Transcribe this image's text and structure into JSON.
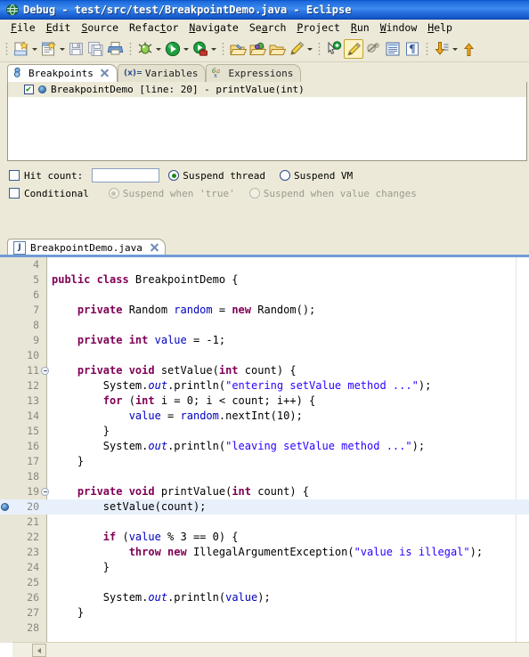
{
  "window": {
    "title": "Debug - test/src/test/BreakpointDemo.java - Eclipse",
    "icon": "eclipse-globe-icon"
  },
  "menubar": {
    "items": [
      {
        "label": "File",
        "mnemonic": "F"
      },
      {
        "label": "Edit",
        "mnemonic": "E"
      },
      {
        "label": "Source",
        "mnemonic": "S"
      },
      {
        "label": "Refactor",
        "mnemonic": "t"
      },
      {
        "label": "Navigate",
        "mnemonic": "N"
      },
      {
        "label": "Search",
        "mnemonic": "a"
      },
      {
        "label": "Project",
        "mnemonic": "P"
      },
      {
        "label": "Run",
        "mnemonic": "R"
      },
      {
        "label": "Window",
        "mnemonic": "W"
      },
      {
        "label": "Help",
        "mnemonic": "H"
      }
    ]
  },
  "toolbar": {
    "groups": [
      {
        "buttons": [
          {
            "icon": "new-wizard-icon",
            "dropdown": true
          },
          {
            "icon": "new-java-class-icon",
            "dropdown": true
          },
          {
            "icon": "save-icon",
            "dropdown": false
          },
          {
            "icon": "save-all-icon",
            "dropdown": false
          },
          {
            "icon": "print-icon",
            "dropdown": false
          }
        ]
      },
      {
        "buttons": [
          {
            "icon": "debug-bug-icon",
            "dropdown": true
          },
          {
            "icon": "run-play-icon",
            "dropdown": true
          },
          {
            "icon": "external-tools-icon",
            "dropdown": true
          }
        ]
      },
      {
        "buttons": [
          {
            "icon": "open-type-icon",
            "dropdown": false
          },
          {
            "icon": "open-task-icon",
            "dropdown": false
          },
          {
            "icon": "open-resource-icon",
            "dropdown": false
          },
          {
            "icon": "quick-fix-pencil-icon",
            "dropdown": true
          }
        ]
      },
      {
        "buttons": [
          {
            "icon": "next-annotation-icon",
            "dropdown": false
          },
          {
            "icon": "toggle-mark-occurrences-icon",
            "dropdown": false,
            "selected": true
          },
          {
            "icon": "skip-breakpoints-icon",
            "dropdown": false
          },
          {
            "icon": "show-whitespace-icon",
            "dropdown": false
          },
          {
            "icon": "pilcrow-icon",
            "dropdown": false
          }
        ]
      },
      {
        "buttons": [
          {
            "icon": "previous-annotation-icon",
            "dropdown": true
          },
          {
            "icon": "next-annotation-up-icon",
            "dropdown": false
          }
        ]
      }
    ]
  },
  "breakpoints_view": {
    "tabs": [
      {
        "label": "Breakpoints",
        "icon": "breakpoints-icon",
        "active": true,
        "closable": true
      },
      {
        "label": "Variables",
        "icon": "variables-icon",
        "active": false,
        "closable": false
      },
      {
        "label": "Expressions",
        "icon": "expressions-icon",
        "active": false,
        "closable": false
      }
    ],
    "items": [
      {
        "checked": true,
        "icon": "breakpoint-dot-icon",
        "label": "BreakpointDemo [line: 20] - printValue(int)"
      }
    ]
  },
  "properties": {
    "hit_count": {
      "label": "Hit count:",
      "checked": false,
      "value": "",
      "placeholder": ""
    },
    "conditional": {
      "label": "Conditional",
      "checked": false,
      "enabled": false
    },
    "suspend_thread": {
      "label": "Suspend thread",
      "selected": true,
      "enabled": true
    },
    "suspend_vm": {
      "label": "Suspend VM",
      "selected": false,
      "enabled": true
    },
    "suspend_when_true": {
      "label": "Suspend when 'true'",
      "selected": true,
      "enabled": false
    },
    "suspend_when_value_changes": {
      "label": "Suspend when value changes",
      "selected": false,
      "enabled": false
    }
  },
  "editor": {
    "tab": {
      "label": "BreakpointDemo.java",
      "icon": "java-file-icon",
      "closable": true
    },
    "scroll_left_button": "scroll-left-arrow",
    "lines": [
      {
        "n": 4,
        "marker": "",
        "fold": false,
        "highlight": false,
        "tokens": [
          {
            "t": "",
            "c": ""
          }
        ]
      },
      {
        "n": 5,
        "marker": "",
        "fold": false,
        "highlight": false,
        "tokens": [
          {
            "t": "public class",
            "c": "kw"
          },
          {
            "t": " BreakpointDemo {",
            "c": ""
          }
        ]
      },
      {
        "n": 6,
        "marker": "",
        "fold": false,
        "highlight": false,
        "tokens": [
          {
            "t": "",
            "c": ""
          }
        ]
      },
      {
        "n": 7,
        "marker": "",
        "fold": false,
        "highlight": false,
        "tokens": [
          {
            "t": "    ",
            "c": ""
          },
          {
            "t": "private",
            "c": "kw"
          },
          {
            "t": " Random ",
            "c": ""
          },
          {
            "t": "random",
            "c": "fld"
          },
          {
            "t": " = ",
            "c": ""
          },
          {
            "t": "new",
            "c": "kw"
          },
          {
            "t": " Random();",
            "c": ""
          }
        ]
      },
      {
        "n": 8,
        "marker": "",
        "fold": false,
        "highlight": false,
        "tokens": [
          {
            "t": "",
            "c": ""
          }
        ]
      },
      {
        "n": 9,
        "marker": "",
        "fold": false,
        "highlight": false,
        "tokens": [
          {
            "t": "    ",
            "c": ""
          },
          {
            "t": "private int",
            "c": "kw"
          },
          {
            "t": " ",
            "c": ""
          },
          {
            "t": "value",
            "c": "fld"
          },
          {
            "t": " = -1;",
            "c": ""
          }
        ]
      },
      {
        "n": 10,
        "marker": "",
        "fold": false,
        "highlight": false,
        "tokens": [
          {
            "t": "",
            "c": ""
          }
        ]
      },
      {
        "n": 11,
        "marker": "",
        "fold": true,
        "highlight": false,
        "tokens": [
          {
            "t": "    ",
            "c": ""
          },
          {
            "t": "private void",
            "c": "kw"
          },
          {
            "t": " setValue(",
            "c": ""
          },
          {
            "t": "int",
            "c": "kw"
          },
          {
            "t": " count) {",
            "c": ""
          }
        ]
      },
      {
        "n": 12,
        "marker": "",
        "fold": false,
        "highlight": false,
        "tokens": [
          {
            "t": "        System.",
            "c": ""
          },
          {
            "t": "out",
            "c": "sfld"
          },
          {
            "t": ".println(",
            "c": ""
          },
          {
            "t": "\"entering setValue method ...\"",
            "c": "str"
          },
          {
            "t": ");",
            "c": ""
          }
        ]
      },
      {
        "n": 13,
        "marker": "",
        "fold": false,
        "highlight": false,
        "tokens": [
          {
            "t": "        ",
            "c": ""
          },
          {
            "t": "for",
            "c": "kw"
          },
          {
            "t": " (",
            "c": ""
          },
          {
            "t": "int",
            "c": "kw"
          },
          {
            "t": " i = 0; i < count; i++) {",
            "c": ""
          }
        ]
      },
      {
        "n": 14,
        "marker": "",
        "fold": false,
        "highlight": false,
        "tokens": [
          {
            "t": "            ",
            "c": ""
          },
          {
            "t": "value",
            "c": "fld"
          },
          {
            "t": " = ",
            "c": ""
          },
          {
            "t": "random",
            "c": "fld"
          },
          {
            "t": ".nextInt(10);",
            "c": ""
          }
        ]
      },
      {
        "n": 15,
        "marker": "",
        "fold": false,
        "highlight": false,
        "tokens": [
          {
            "t": "        }",
            "c": ""
          }
        ]
      },
      {
        "n": 16,
        "marker": "",
        "fold": false,
        "highlight": false,
        "tokens": [
          {
            "t": "        System.",
            "c": ""
          },
          {
            "t": "out",
            "c": "sfld"
          },
          {
            "t": ".println(",
            "c": ""
          },
          {
            "t": "\"leaving setValue method ...\"",
            "c": "str"
          },
          {
            "t": ");",
            "c": ""
          }
        ]
      },
      {
        "n": 17,
        "marker": "",
        "fold": false,
        "highlight": false,
        "tokens": [
          {
            "t": "    }",
            "c": ""
          }
        ]
      },
      {
        "n": 18,
        "marker": "",
        "fold": false,
        "highlight": false,
        "tokens": [
          {
            "t": "",
            "c": ""
          }
        ]
      },
      {
        "n": 19,
        "marker": "",
        "fold": true,
        "highlight": false,
        "tokens": [
          {
            "t": "    ",
            "c": ""
          },
          {
            "t": "private void",
            "c": "kw"
          },
          {
            "t": " printValue(",
            "c": ""
          },
          {
            "t": "int",
            "c": "kw"
          },
          {
            "t": " count) {",
            "c": ""
          }
        ]
      },
      {
        "n": 20,
        "marker": "breakpoint",
        "fold": false,
        "highlight": true,
        "tokens": [
          {
            "t": "        setValue(count);",
            "c": ""
          }
        ]
      },
      {
        "n": 21,
        "marker": "",
        "fold": false,
        "highlight": false,
        "tokens": [
          {
            "t": "",
            "c": ""
          }
        ]
      },
      {
        "n": 22,
        "marker": "",
        "fold": false,
        "highlight": false,
        "tokens": [
          {
            "t": "        ",
            "c": ""
          },
          {
            "t": "if",
            "c": "kw"
          },
          {
            "t": " (",
            "c": ""
          },
          {
            "t": "value",
            "c": "fld"
          },
          {
            "t": " % 3 == 0) {",
            "c": ""
          }
        ]
      },
      {
        "n": 23,
        "marker": "",
        "fold": false,
        "highlight": false,
        "tokens": [
          {
            "t": "            ",
            "c": ""
          },
          {
            "t": "throw new",
            "c": "kw"
          },
          {
            "t": " IllegalArgumentException(",
            "c": ""
          },
          {
            "t": "\"value is illegal\"",
            "c": "str"
          },
          {
            "t": ");",
            "c": ""
          }
        ]
      },
      {
        "n": 24,
        "marker": "",
        "fold": false,
        "highlight": false,
        "tokens": [
          {
            "t": "        }",
            "c": ""
          }
        ]
      },
      {
        "n": 25,
        "marker": "",
        "fold": false,
        "highlight": false,
        "tokens": [
          {
            "t": "",
            "c": ""
          }
        ]
      },
      {
        "n": 26,
        "marker": "",
        "fold": false,
        "highlight": false,
        "tokens": [
          {
            "t": "        System.",
            "c": ""
          },
          {
            "t": "out",
            "c": "sfld"
          },
          {
            "t": ".println(",
            "c": ""
          },
          {
            "t": "value",
            "c": "fld"
          },
          {
            "t": ");",
            "c": ""
          }
        ]
      },
      {
        "n": 27,
        "marker": "",
        "fold": false,
        "highlight": false,
        "tokens": [
          {
            "t": "    }",
            "c": ""
          }
        ]
      },
      {
        "n": 28,
        "marker": "",
        "fold": false,
        "highlight": false,
        "tokens": [
          {
            "t": "",
            "c": ""
          }
        ]
      }
    ]
  },
  "colors": {
    "title_bar": "#1c6bdc",
    "chrome": "#ece9d8",
    "keyword": "#7f0055",
    "string": "#2a00ff",
    "field": "#0000c0",
    "line_highlight": "#e8f0fb",
    "gutter": "#e8e6d6",
    "accent_strip": "#b9cbe6"
  }
}
